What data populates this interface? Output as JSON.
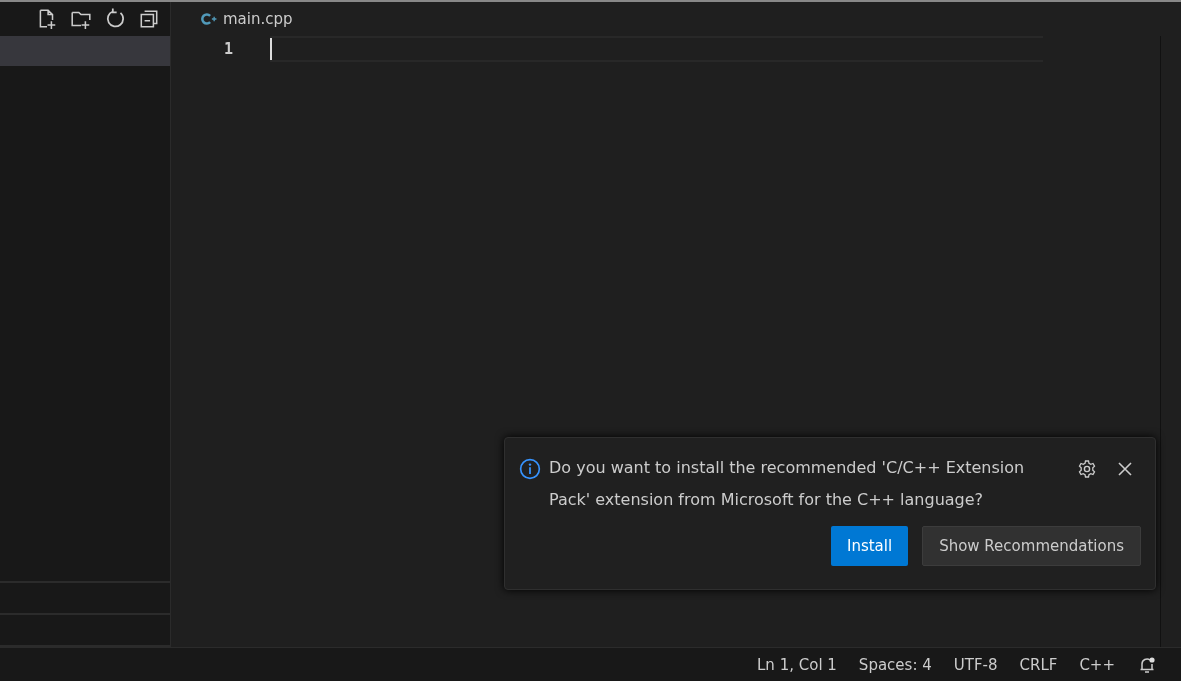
{
  "editor": {
    "tab": {
      "label": "main.cpp"
    },
    "line_numbers": [
      "1"
    ]
  },
  "notification": {
    "message": "Do you want to install the recommended 'C/C++ Extension Pack' extension from Microsoft for the C++ language?",
    "buttons": [
      {
        "label": "Install",
        "kind": "primary"
      },
      {
        "label": "Show Recommendations",
        "kind": "secondary"
      }
    ]
  },
  "status_bar": {
    "items": [
      "Ln 1, Col 1",
      "Spaces: 4",
      "UTF-8",
      "CRLF",
      "C++"
    ]
  }
}
